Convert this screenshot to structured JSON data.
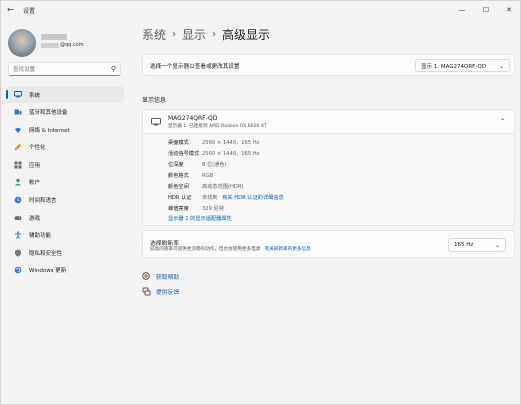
{
  "window": {
    "title": "设置",
    "minimize": "—",
    "maximize": "☐",
    "close": "✕"
  },
  "account": {
    "email_suffix": "@qq.com"
  },
  "search": {
    "placeholder": "查找设置"
  },
  "nav": [
    {
      "label": "系统",
      "icon": "system-icon",
      "active": true
    },
    {
      "label": "蓝牙和其他设备",
      "icon": "bluetooth-icon"
    },
    {
      "label": "网络 & Internet",
      "icon": "wifi-icon"
    },
    {
      "label": "个性化",
      "icon": "brush-icon"
    },
    {
      "label": "应用",
      "icon": "apps-icon"
    },
    {
      "label": "帐户",
      "icon": "person-icon"
    },
    {
      "label": "时间和语言",
      "icon": "globe-clock-icon"
    },
    {
      "label": "游戏",
      "icon": "gamepad-icon"
    },
    {
      "label": "辅助功能",
      "icon": "accessibility-icon"
    },
    {
      "label": "隐私和安全性",
      "icon": "shield-icon"
    },
    {
      "label": "Windows 更新",
      "icon": "update-icon"
    }
  ],
  "breadcrumb": {
    "first": "系统",
    "second": "显示",
    "current": "高级显示",
    "separator": "›"
  },
  "display_select": {
    "label": "选择一个显示器以查看或更改其设置",
    "value": "显示 1: MAG274QRF-QD"
  },
  "display_info": {
    "section_title": "显示信息",
    "monitor_name": "MAG274QRF-QD",
    "monitor_sub": "显示器 1: 已连接到 AMD Radeon RX 6600 XT",
    "rows": [
      {
        "key": "桌面模式",
        "value": "2560 × 1440，165 Hz"
      },
      {
        "key": "活动信号模式",
        "value": "2560 × 1440，165 Hz"
      },
      {
        "key": "位深度",
        "value": "8 位(通色)"
      },
      {
        "key": "颜色格式",
        "value": "RGB"
      },
      {
        "key": "颜色空间",
        "value": "高动态范围(HDR)"
      },
      {
        "key": "HDR 认证",
        "value": "未找到",
        "link": "有关 HDR 认证的详细信息"
      },
      {
        "key": "峰值亮度",
        "value": "329 尼特"
      }
    ],
    "adapter_link": "显示器 1 的显示适配器属性"
  },
  "refresh_rate": {
    "title": "选择刷新率",
    "description": "较高的速率可提供更流畅的动作，但也会使用更多电源",
    "link": "有关刷新率的更多信息",
    "value": "165 Hz"
  },
  "help": {
    "get_help": "获取帮助",
    "feedback": "提供反馈"
  },
  "colors": {
    "accent": "#005fb8"
  }
}
